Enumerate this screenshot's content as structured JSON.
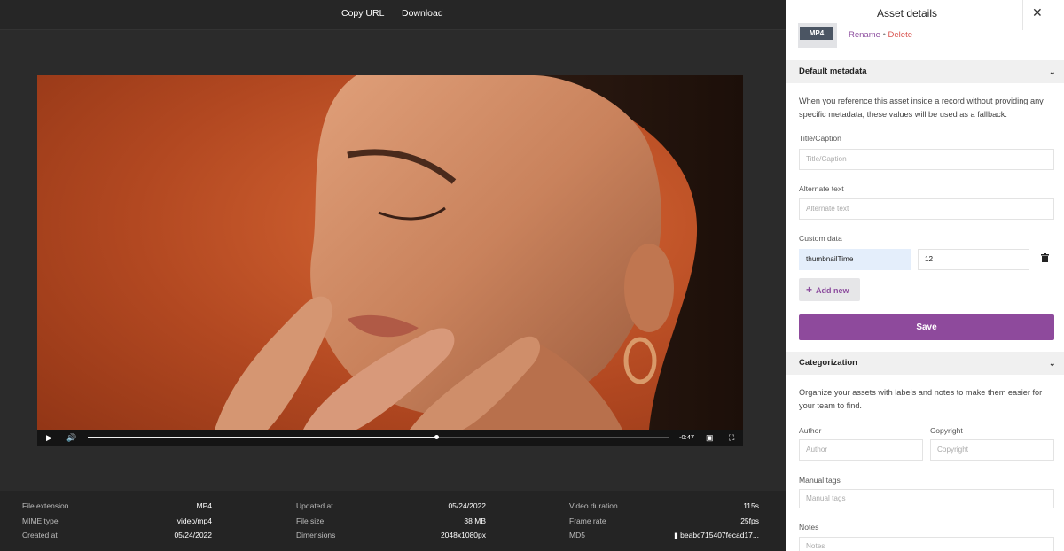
{
  "topbar": {
    "copy_url": "Copy URL",
    "download": "Download"
  },
  "player": {
    "time": "-0:47",
    "progress": 0.6
  },
  "meta": {
    "col1": [
      {
        "k": "File extension",
        "v": "MP4"
      },
      {
        "k": "MIME type",
        "v": "video/mp4"
      },
      {
        "k": "Created at",
        "v": "05/24/2022"
      }
    ],
    "col2": [
      {
        "k": "Updated at",
        "v": "05/24/2022"
      },
      {
        "k": "File size",
        "v": "38 MB"
      },
      {
        "k": "Dimensions",
        "v": "2048x1080px"
      }
    ],
    "col3": [
      {
        "k": "Video duration",
        "v": "115s"
      },
      {
        "k": "Frame rate",
        "v": "25fps"
      },
      {
        "k": "MD5",
        "v": "beabc715407fecad17..."
      }
    ]
  },
  "panel": {
    "title": "Asset details",
    "close": "✕",
    "thumb_badge": "MP4",
    "rename": "Rename",
    "separator": "•",
    "delete": "Delete",
    "default_metadata": {
      "heading": "Default metadata",
      "help": "When you reference this asset inside a record without providing any specific metadata, these values will be used as a fallback.",
      "title_label": "Title/Caption",
      "title_placeholder": "Title/Caption",
      "alt_label": "Alternate text",
      "alt_placeholder": "Alternate text",
      "custom_label": "Custom data",
      "custom_key": "thumbnailTime",
      "custom_value": "12",
      "add_new": "Add new",
      "save": "Save"
    },
    "categorization": {
      "heading": "Categorization",
      "help": "Organize your assets with labels and notes to make them easier for your team to find.",
      "author_label": "Author",
      "author_placeholder": "Author",
      "copyright_label": "Copyright",
      "copyright_placeholder": "Copyright",
      "tags_label": "Manual tags",
      "tags_placeholder": "Manual tags",
      "notes_label": "Notes",
      "notes_placeholder": "Notes"
    }
  },
  "colors": {
    "accent": "#8e4a9c",
    "delete": "#d9534f",
    "panel_bg": "#ffffff",
    "viewer_bg": "#2b2b2b"
  }
}
